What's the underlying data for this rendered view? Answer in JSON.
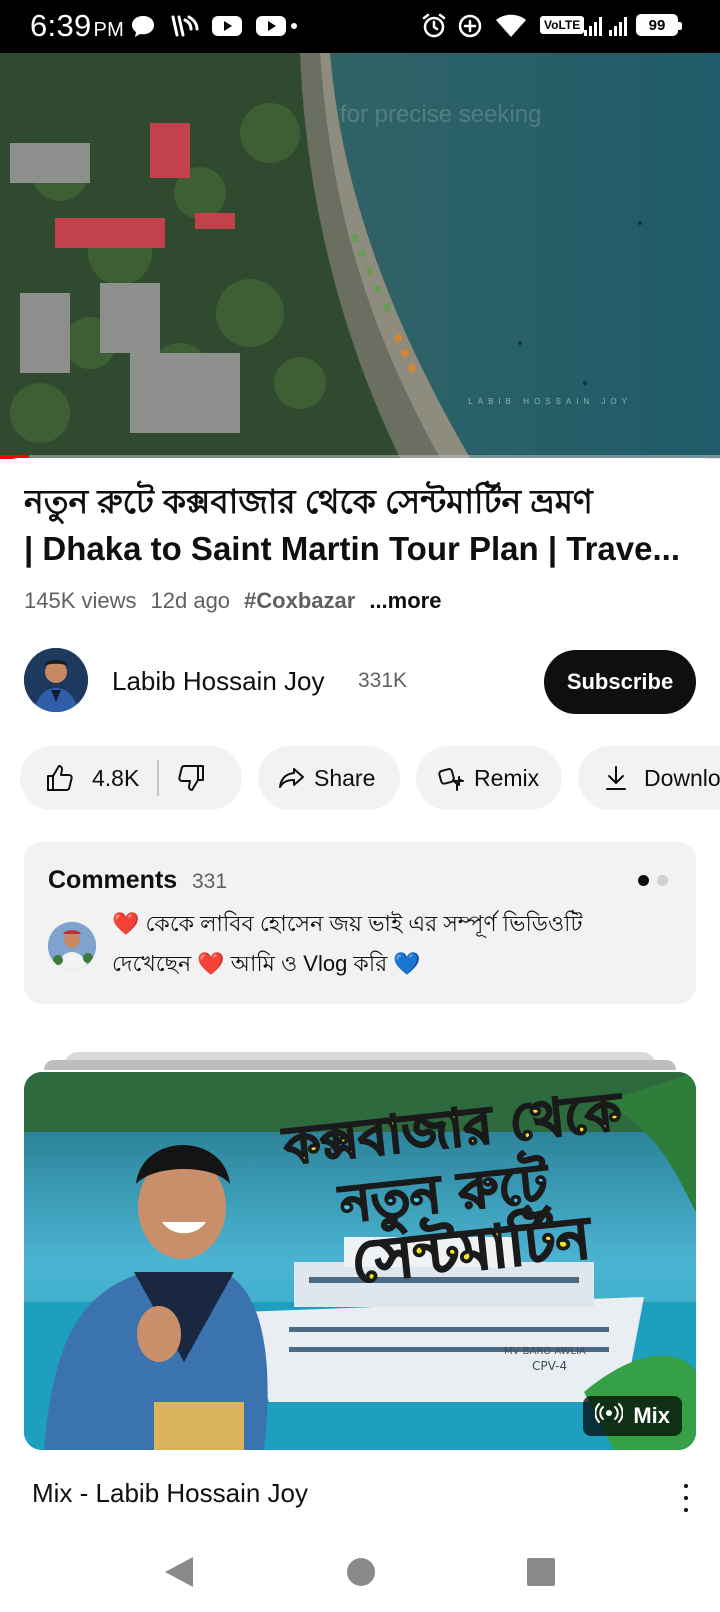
{
  "status_bar": {
    "time": "6:39",
    "ampm": "PM",
    "network": "VoLTE",
    "battery": "99",
    "icons": [
      "chat-bubble-icon",
      "wifi-calling-icon",
      "youtube-icon",
      "youtube-dot-icon",
      "alarm-icon",
      "data-saver-icon",
      "wifi-icon",
      "signal-icon"
    ]
  },
  "video": {
    "seek_hint": "for precise seeking",
    "watermark": "LABIB HOSSAIN JOY",
    "progress": 0.04
  },
  "title": {
    "line1": "নতুন রুটে কক্সবাজার থেকে সেন্টমার্টিন ভ্রমণ",
    "line2": "| Dhaka to Saint Martin Tour Plan | Trave..."
  },
  "meta": {
    "views": "145K views",
    "age": "12d ago",
    "hashtag": "#Coxbazar",
    "more": "...more"
  },
  "channel": {
    "name": "Labib Hossain Joy",
    "subscribers": "331K",
    "subscribe_label": "Subscribe"
  },
  "actions": {
    "likes": "4.8K",
    "share": "Share",
    "remix": "Remix",
    "download": "Download"
  },
  "comments": {
    "title": "Comments",
    "count": "331",
    "pinned_text_line1": "❤️ কেকে লাবিব হোসেন জয় ভাই এর সম্পূর্ণ ভিডিওটি",
    "pinned_text_line2": "দেখেছেন ❤️ আমি ও Vlog করি 💙"
  },
  "next_up": {
    "thumb_text_line1": "কক্সবাজার থেকে",
    "thumb_text_line2": "নতুন রুটে",
    "thumb_text_line3": "সেন্টমার্টিন",
    "ship_name": "MV BARO AWLIA",
    "ship_code": "CPV-4",
    "badge": "Mix",
    "title": "Mix - Labib Hossain Joy"
  },
  "colors": {
    "accent": "#ff0000",
    "pill_bg": "#f2f2f2",
    "text": "#0f0f0f",
    "secondary_text": "#606060",
    "thumb_text_yellow": "#f5e51b"
  }
}
